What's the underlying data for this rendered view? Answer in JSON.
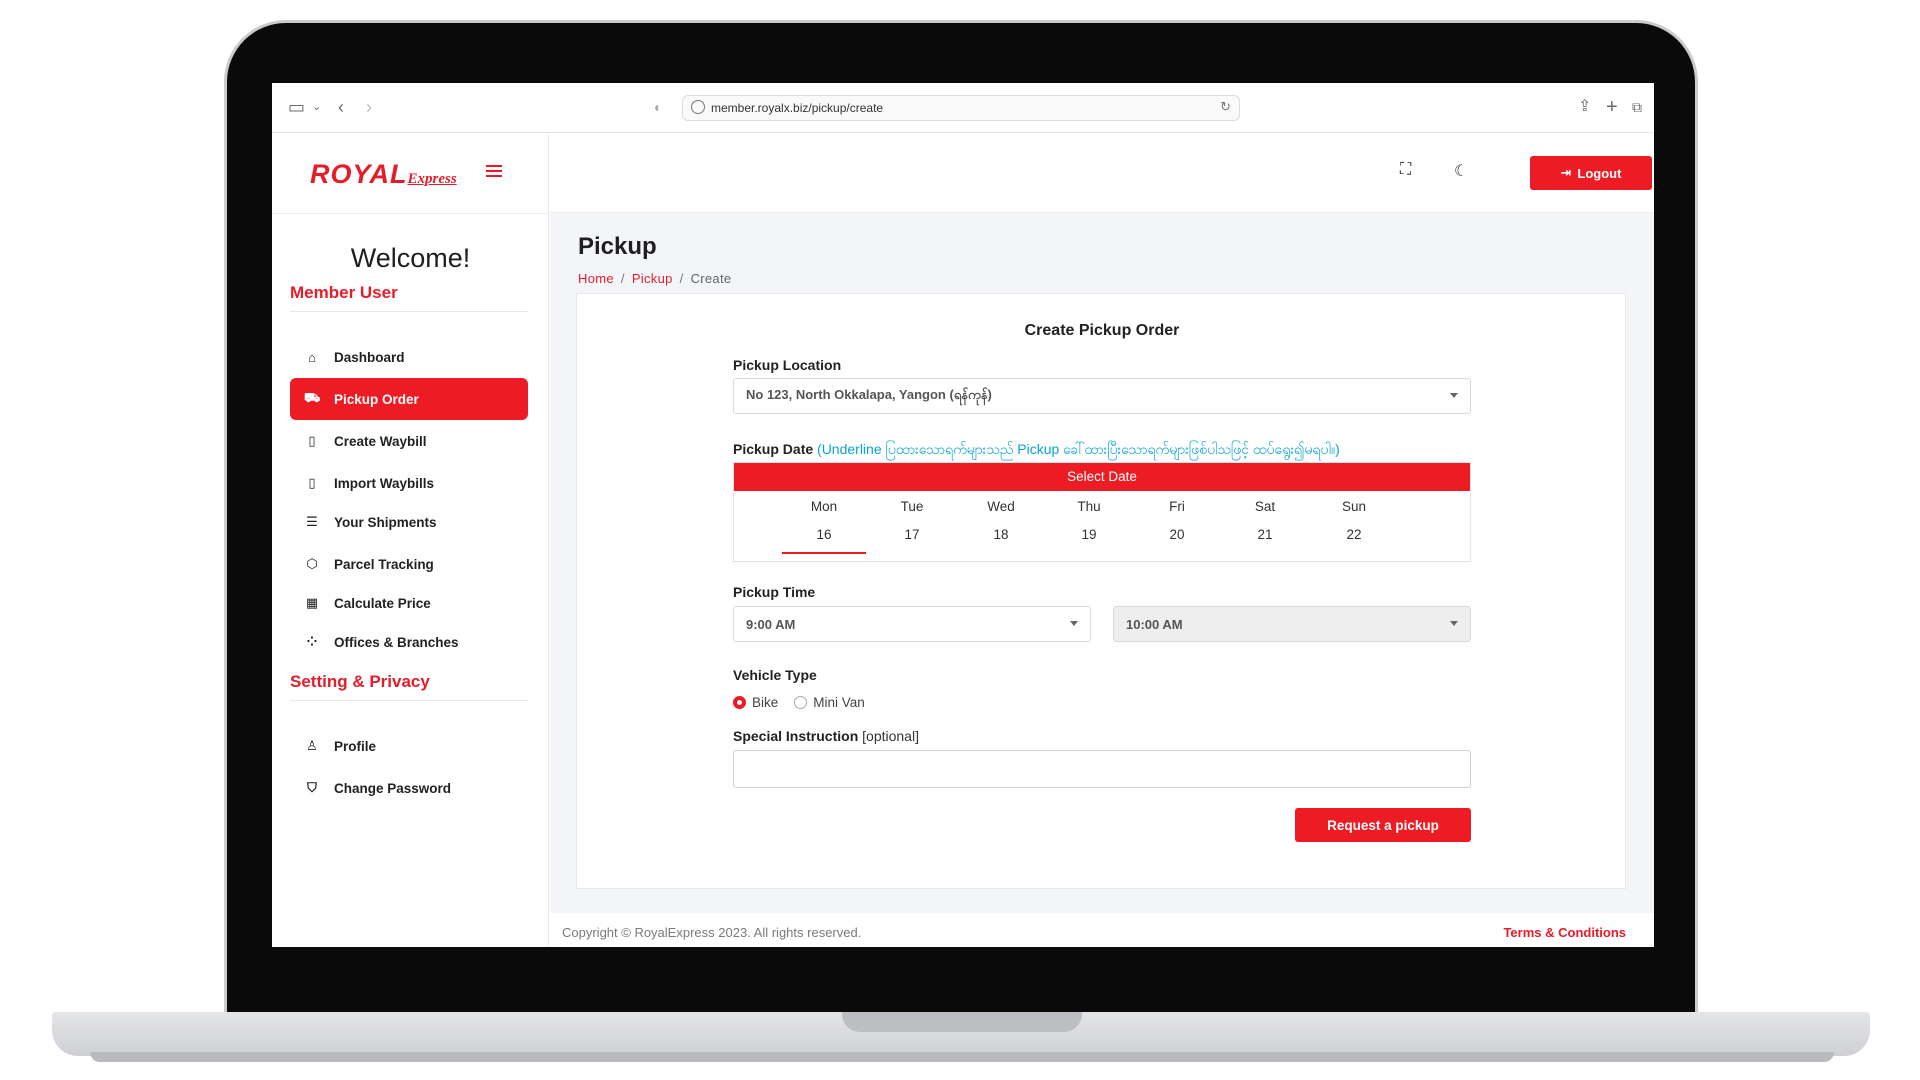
{
  "browser": {
    "url": "member.royalx.biz/pickup/create"
  },
  "brand": {
    "logo_main": "ROYAL",
    "logo_sub": "Express",
    "accent": "#ed1c24",
    "hint_color": "#0aa5d1"
  },
  "sidebar": {
    "welcome": "Welcome!",
    "section_member": "Member User",
    "items": [
      {
        "label": "Dashboard",
        "icon": "home-icon"
      },
      {
        "label": "Pickup Order",
        "icon": "truck-icon",
        "active": true
      },
      {
        "label": "Create Waybill",
        "icon": "phone-icon"
      },
      {
        "label": "Import Waybills",
        "icon": "phone-icon"
      },
      {
        "label": "Your Shipments",
        "icon": "list-icon"
      },
      {
        "label": "Parcel Tracking",
        "icon": "box-icon"
      },
      {
        "label": "Calculate Price",
        "icon": "calculator-icon"
      },
      {
        "label": "Offices & Branches",
        "icon": "route-icon"
      }
    ],
    "section_settings": "Setting & Privacy",
    "settings_items": [
      {
        "label": "Profile",
        "icon": "user-icon"
      },
      {
        "label": "Change Password",
        "icon": "shield-icon"
      }
    ]
  },
  "topbar": {
    "logout_label": "Logout"
  },
  "page": {
    "title": "Pickup",
    "breadcrumb": [
      "Home",
      "Pickup",
      "Create"
    ]
  },
  "form": {
    "title": "Create Pickup Order",
    "location_label": "Pickup Location",
    "location_value": "No 123, North Okkalapa, Yangon (ရန်ကုန်)",
    "date_label": "Pickup Date",
    "date_hint": "(Underline ပြထားသောရက်များသည် Pickup ခေါ်ထားပြီးသောရက်များဖြစ်ပါသဖြင့် ထပ်ရွေး၍မရပါ။)",
    "date_header": "Select Date",
    "days": [
      {
        "name": "Mon",
        "num": "16",
        "selected": true
      },
      {
        "name": "Tue",
        "num": "17"
      },
      {
        "name": "Wed",
        "num": "18"
      },
      {
        "name": "Thu",
        "num": "19"
      },
      {
        "name": "Fri",
        "num": "20"
      },
      {
        "name": "Sat",
        "num": "21"
      },
      {
        "name": "Sun",
        "num": "22"
      }
    ],
    "time_label": "Pickup Time",
    "time_from": "9:00 AM",
    "time_to": "10:00 AM",
    "vehicle_label": "Vehicle Type",
    "vehicle_options": [
      {
        "label": "Bike",
        "checked": true
      },
      {
        "label": "Mini Van",
        "checked": false
      }
    ],
    "instruction_label": "Special Instruction",
    "instruction_optional": "[optional]",
    "instruction_value": "",
    "submit_label": "Request a pickup"
  },
  "footer": {
    "copyright": "Copyright © RoyalExpress 2023. All rights reserved.",
    "terms": "Terms & Conditions"
  }
}
